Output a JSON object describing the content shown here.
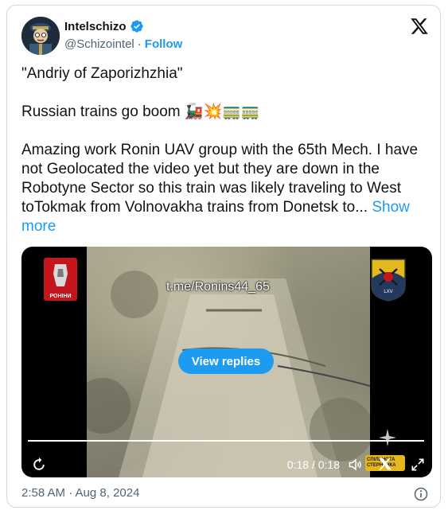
{
  "author": {
    "name": "Intelschizo",
    "handle": "@Schizointel",
    "separator": "·",
    "follow_label": "Follow"
  },
  "tweet": {
    "line1": "\"Andriy of Zaporizhzhia\"",
    "line2": "Russian trains go boom 🚂💥🚃🚃",
    "line3": "Amazing work Ronin UAV group with the 65th Mech. I have not  Geolocated the video yet but they are down in the Robotyne Sector so this train was likely traveling to West toTokmak from Volnovakha trains from Donetsk to...",
    "show_more": "Show more"
  },
  "media": {
    "watermark": "t.me/Ronins44_65",
    "view_replies_label": "View replies",
    "time_display": "0:18 / 0:18",
    "left_logo_text": "РОНІНИ",
    "right_logo_text": "LXV",
    "corner_logo_text": "СПІЛЬНОТА СТЕРНЕНКА",
    "progress": 1.0
  },
  "footer": {
    "timestamp": "2:58 AM · Aug 8, 2024"
  },
  "colors": {
    "accent": "#1d9bf0",
    "text": "#0f1419",
    "muted": "#536471",
    "border": "#cfd9de"
  },
  "icons": [
    "verified-badge-icon",
    "x-logo-icon",
    "replay-icon",
    "volume-icon",
    "expand-icon",
    "info-icon"
  ]
}
